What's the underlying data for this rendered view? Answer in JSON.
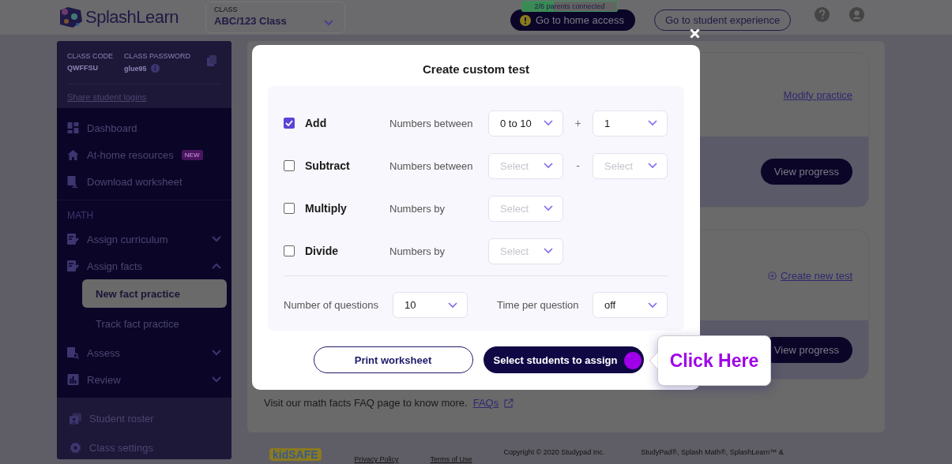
{
  "header": {
    "logo": "SplashLearn",
    "class_selector": {
      "label": "CLASS",
      "value": "ABC/123 Class"
    },
    "parents_badge": {
      "text": "2/6 parents connected",
      "level": 0.33
    },
    "home_access_button": "Go to home access",
    "student_experience_button": "Go to student experience"
  },
  "sidebar": {
    "class_code": {
      "label": "CLASS CODE",
      "value": "QWFFSU"
    },
    "class_password": {
      "label": "CLASS PASSWORD",
      "value": "glue95"
    },
    "share_link": "Share student logins",
    "top_items": [
      {
        "label": "Dashboard"
      },
      {
        "label": "At-home resources",
        "badge": "NEW"
      },
      {
        "label": "Download worksheet"
      }
    ],
    "section": "MATH",
    "math_items": [
      {
        "label": "Assign curriculum",
        "expanded": false
      },
      {
        "label": "Assign facts",
        "expanded": true,
        "children": [
          {
            "label": "New fact practice",
            "selected": true
          },
          {
            "label": "Track fact practice",
            "selected": false
          }
        ]
      },
      {
        "label": "Assess",
        "expanded": false
      },
      {
        "label": "Review",
        "expanded": false
      }
    ],
    "bottom_items": [
      {
        "label": "Student roster"
      },
      {
        "label": "Class settings"
      }
    ]
  },
  "main": {
    "cards": [
      {
        "link": "Modify practice",
        "button": "View progress"
      },
      {
        "link": "Create new test",
        "button": "View progress"
      }
    ],
    "faq": {
      "text": "Visit our math facts FAQ page to know more.",
      "link": "FAQs"
    },
    "footer": {
      "badge": "kidSAFE",
      "links": [
        "Privacy Policy",
        "Terms of Use"
      ],
      "notes": [
        "Copyright © 2020 Studypad Inc.",
        "StudyPad®, Splash Math®, SplashLearn™ &"
      ]
    }
  },
  "modal": {
    "title": "Create custom test",
    "operations": [
      {
        "name": "Add",
        "checked": true,
        "description": "Numbers between",
        "selects": [
          {
            "value": "0 to 10"
          },
          {
            "value": "1"
          }
        ],
        "operator": "+"
      },
      {
        "name": "Subtract",
        "checked": false,
        "description": "Numbers between",
        "selects": [
          {
            "placeholder": "Select"
          },
          {
            "placeholder": "Select"
          }
        ],
        "operator": "-"
      },
      {
        "name": "Multiply",
        "checked": false,
        "description": "Numbers by",
        "selects": [
          {
            "placeholder": "Select"
          }
        ]
      },
      {
        "name": "Divide",
        "checked": false,
        "description": "Numbers by",
        "selects": [
          {
            "placeholder": "Select"
          }
        ]
      }
    ],
    "number_of_questions": {
      "label": "Number of questions",
      "value": "10"
    },
    "time_per_question": {
      "label": "Time per question",
      "value": "off"
    },
    "print_button": "Print worksheet",
    "assign_button": "Select students to assign",
    "tooltip": "Click Here"
  }
}
